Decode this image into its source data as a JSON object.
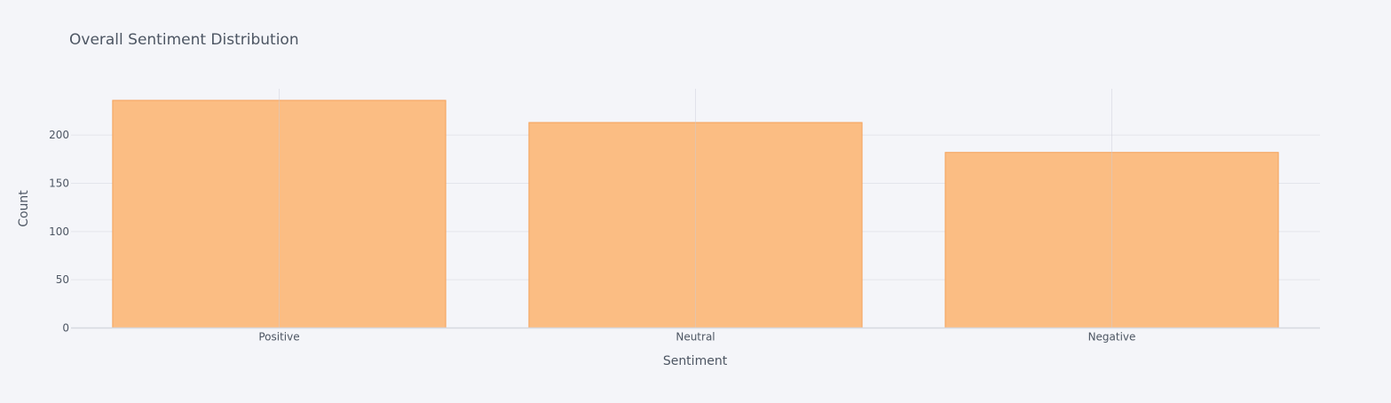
{
  "chart_data": {
    "type": "bar",
    "title": "Overall Sentiment Distribution",
    "xlabel": "Sentiment",
    "ylabel": "Count",
    "categories": [
      "Positive",
      "Neutral",
      "Negative"
    ],
    "values": [
      236,
      213,
      182
    ],
    "ylim": [
      0,
      248
    ],
    "yticks": [
      0,
      50,
      100,
      150,
      200
    ],
    "grid": true,
    "legend": "none"
  },
  "colors": {
    "background": "#F4F5F9",
    "bar_fill": "#FBBD83",
    "bar_stroke": "#F5A25A",
    "grid": "#E3E5EC",
    "axis_line": "#D6D9E0",
    "title_text": "#4D5663",
    "tick_text": "#4D5663"
  }
}
